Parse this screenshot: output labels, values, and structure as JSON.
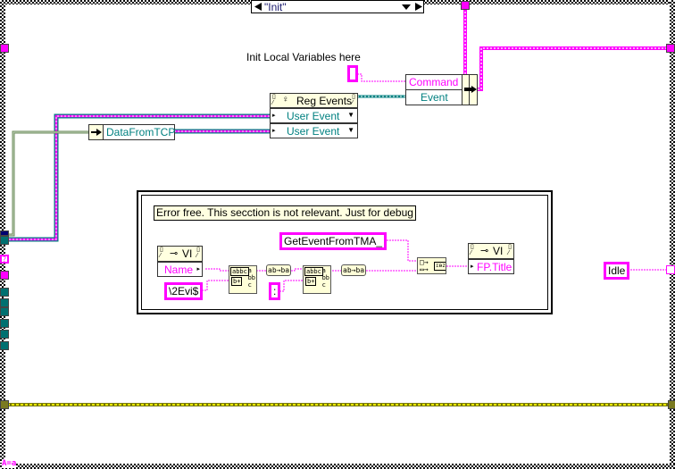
{
  "case_selector": {
    "value": "\"Init\"",
    "prev_icon": "triangle-left-icon",
    "next_icon": "triangle-right-icon",
    "dropdown_icon": "chevron-down-icon"
  },
  "labels": {
    "init_local_vars": "Init Local Variables here"
  },
  "bundle_node": {
    "field1": "Command",
    "field2": "Event"
  },
  "reg_events": {
    "title": "Reg Events",
    "inputs": [
      "User Event",
      "User Event"
    ]
  },
  "data_from_tcp": {
    "label": "DataFromTCP"
  },
  "debug_section": {
    "comment": "Error free. This secction is not relevant. Just for debug",
    "vi_property_node_1": {
      "title": "VI",
      "property": "Name"
    },
    "vi_property_node_2": {
      "title": "VI",
      "property": "FP.Title"
    },
    "const_regex": "\\2Evi$",
    "const_colon": ":",
    "const_get_event": "GetEventFromTMA_",
    "reverse_label": "ab→ba",
    "match_icon_text": "abbc"
  },
  "idle_const": "Idle",
  "footer_badge": "A=a",
  "colors": {
    "string_wire": "#ff00ff",
    "refnum_wire": "#008080",
    "error_wire": "#a0a000",
    "cluster_wire": "#6a8a5a"
  }
}
